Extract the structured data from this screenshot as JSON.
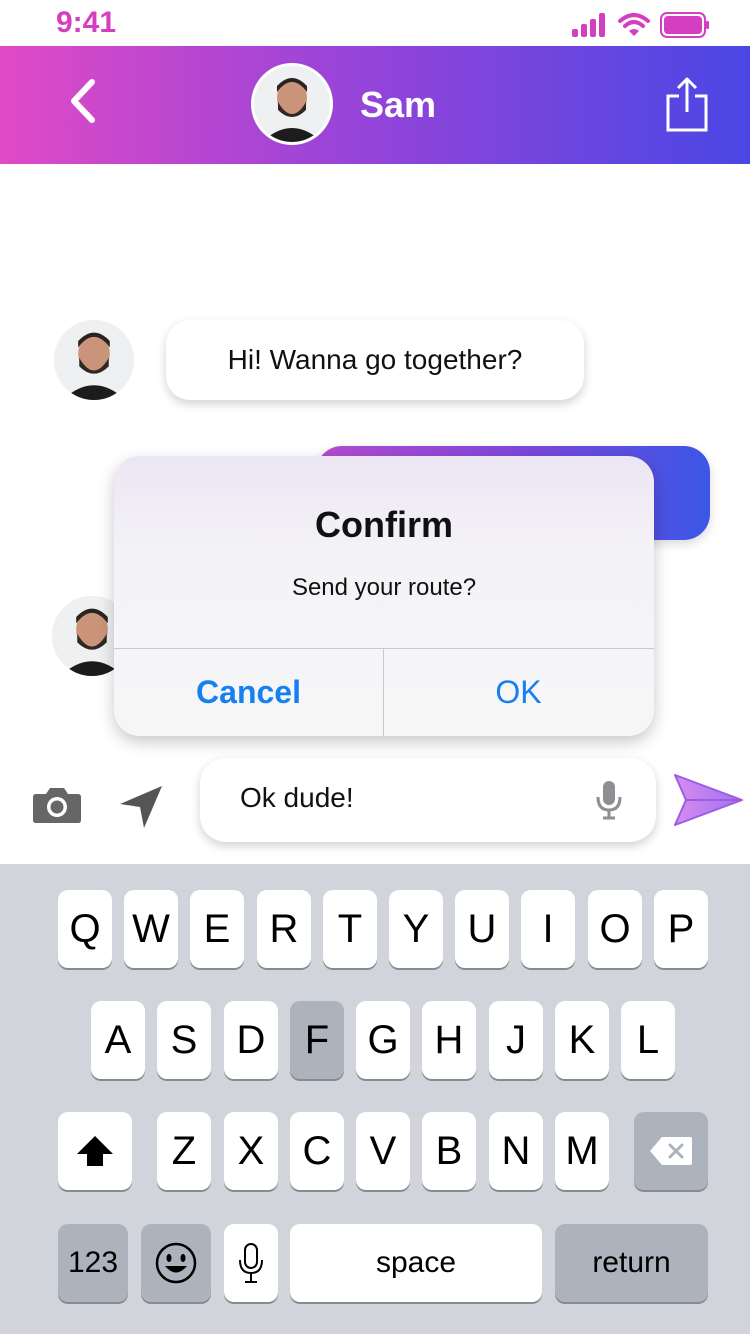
{
  "status_bar": {
    "time": "9:41"
  },
  "header": {
    "contact_name": "Sam"
  },
  "messages": [
    {
      "from": "Sam",
      "text": "Hi! Wanna go together?"
    }
  ],
  "alert": {
    "title": "Confirm",
    "message": "Send your route?",
    "cancel_label": "Cancel",
    "ok_label": "OK"
  },
  "composer": {
    "value": "Ok dude!"
  },
  "keyboard": {
    "row1": [
      "Q",
      "W",
      "E",
      "R",
      "T",
      "Y",
      "U",
      "I",
      "O",
      "P"
    ],
    "row2": [
      "A",
      "S",
      "D",
      "F",
      "G",
      "H",
      "J",
      "K",
      "L"
    ],
    "row3": [
      "Z",
      "X",
      "C",
      "V",
      "B",
      "N",
      "M"
    ],
    "numbers_label": "123",
    "space_label": "space",
    "return_label": "return",
    "highlighted_key": "F"
  },
  "colors": {
    "accent_pink": "#e04ac6",
    "accent_blue": "#4a46e4",
    "link_blue": "#1580f0",
    "keyboard_bg": "#d1d4da"
  },
  "icons": [
    "back-chevron-icon",
    "share-icon",
    "camera-icon",
    "location-arrow-icon",
    "microphone-icon",
    "send-icon",
    "shift-icon",
    "delete-icon",
    "emoji-icon",
    "dictation-icon",
    "signal-icon",
    "wifi-icon",
    "battery-icon"
  ]
}
